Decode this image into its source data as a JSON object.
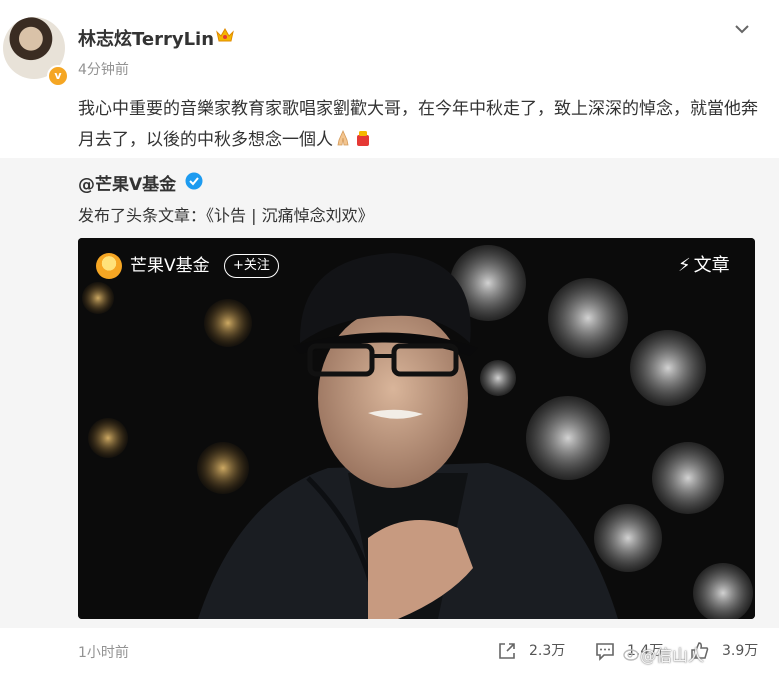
{
  "post": {
    "username": "林志炫TerryLin",
    "time_ago": "4分钟前",
    "text": "我心中重要的音樂家教育家歌唱家劉歡大哥，在今年中秋走了，致上深深的悼念，就當他奔月去了，以後的中秋多想念一個人",
    "avatar_badge": "v"
  },
  "repost": {
    "author": "@芒果V基金",
    "text": "发布了头条文章：《讣告 | 沉痛悼念刘欢》",
    "card": {
      "account": "芒果V基金",
      "follow_label": "+关注",
      "tag_label": "文章"
    }
  },
  "footer": {
    "post_time": "1小时前",
    "share_count": "2.3万",
    "comment_count": "1.4万",
    "like_count": "3.9万",
    "watermark": "@信山人"
  },
  "colors": {
    "accent_orange": "#f5a623",
    "verified_blue": "#1d9bf0",
    "muted_text": "#939393",
    "repost_bg": "#f5f5f5"
  },
  "icons": [
    "crown-icon",
    "chevron-down-icon",
    "pray-icon",
    "mooncake-icon",
    "verified-icon",
    "bolt-icon",
    "share-icon",
    "comment-icon",
    "like-icon",
    "weibo-watermark-icon"
  ]
}
